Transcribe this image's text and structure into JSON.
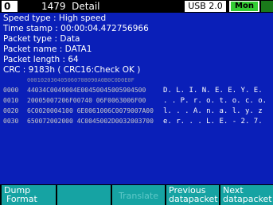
{
  "header": {
    "index_label": "0",
    "title": "1479  Detail",
    "usb_label": "USB 2.0",
    "mon_label": "Mon"
  },
  "fields": {
    "speed": "Speed type : High speed",
    "timestamp": "Time stamp : 00:00:04.472756966",
    "packet_type": "Packet type : Data",
    "packet_name": "Packet name : DATA1",
    "packet_length": "Packet length : 64",
    "crc": "CRC : 9183h ( CRC16:Check OK )"
  },
  "hex_header": "000102030405060708090A0B0C0D0E0F",
  "rows": [
    {
      "offset": "0000",
      "hex": "44034C0049004E00450045005904500",
      "ascii": "D. L. I. N. E. E. Y. E."
    },
    {
      "offset": "0010",
      "hex": "20005007206F00740 06F0063006F00",
      "ascii": ". . P. r. o. t. o. c. o."
    },
    {
      "offset": "0020",
      "hex": "6C0020004100 6E0061006C0079007A00",
      "ascii": "l. . . A. n. a. l. y. z"
    },
    {
      "offset": "0030",
      "hex": "650072002000 4C0045002D0032003700",
      "ascii": "e. r. . . L. E. - 2. 7."
    }
  ],
  "softkeys": {
    "k1a": "Dump",
    "k1b": "Format",
    "k2": "",
    "k3": "Translate",
    "k4a": "Previous",
    "k4b": "datapacket",
    "k5a": "Next",
    "k5b": "datapacket"
  },
  "colors": {
    "background": "#0a1fb8",
    "softkey": "#16a3a3",
    "mon_green": "#33cc33"
  }
}
